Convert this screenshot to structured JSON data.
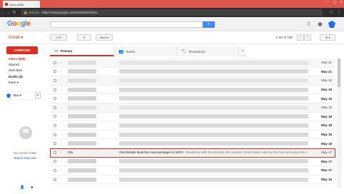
{
  "browser": {
    "tab_title": "Inbox (669)",
    "secure_label": "Secure",
    "url": "https://mail.google.com/mail/u/0/#inbox",
    "tab_close": "×",
    "back": "←",
    "forward": "→",
    "reload": "↻"
  },
  "header": {
    "logo_letters": [
      {
        "ch": "G",
        "color": "#4285f4"
      },
      {
        "ch": "o",
        "color": "#ea4335"
      },
      {
        "ch": "o",
        "color": "#fbbc05"
      },
      {
        "ch": "g",
        "color": "#4285f4"
      },
      {
        "ch": "l",
        "color": "#34a853"
      },
      {
        "ch": "e",
        "color": "#ea4335"
      }
    ],
    "search_icon": "⌕",
    "apps_icon": "⠿",
    "bell_icon": "◉"
  },
  "toolbar": {
    "gmail_label": "Gmail ▾",
    "refresh": "↻",
    "more_label": "More ▾",
    "pager": "1–50 of 739",
    "prev": "‹",
    "next": "›",
    "settings": "⚙ ▾"
  },
  "sidebar": {
    "compose": "COMPOSE",
    "items": [
      {
        "label": "Inbox (669)",
        "style": "active"
      },
      {
        "label": "Starred",
        "style": ""
      },
      {
        "label": "Sent Mail",
        "style": ""
      },
      {
        "label": "Drafts (4)",
        "style": "bold"
      },
      {
        "label": "More ▾",
        "style": ""
      }
    ],
    "hangouts_user": "Star ▾",
    "hangouts_plus": "+",
    "no_chats": "No recent chats",
    "start_new": "Start a new one"
  },
  "tabs": [
    {
      "label": "Primary",
      "icon": "▭",
      "active": true
    },
    {
      "label": "Social",
      "icon": "👥",
      "active": false
    },
    {
      "label": "Promotions",
      "icon": "🏷",
      "active": false
    }
  ],
  "tabs_plus": "+",
  "messages": [
    {
      "date": "May 21",
      "read": true
    },
    {
      "date": "May 21",
      "read": false
    },
    {
      "date": "May 19",
      "read": true
    },
    {
      "date": "May 19",
      "read": false
    },
    {
      "date": "May 19",
      "read": false
    },
    {
      "date": "May 18",
      "read": true
    },
    {
      "date": "May 18",
      "read": false
    },
    {
      "date": "May 18",
      "read": false
    },
    {
      "date": "May 18",
      "read": false
    },
    {
      "date": "May 18",
      "read": false
    },
    {
      "sender": "Ola",
      "subject": "Ola Rentals launches new packages in NCR!",
      "snippet": " - Breakfree with Ola Rentals this summer. Book these cabs by the hour and enjoy the c",
      "date": "May 17",
      "read": true,
      "highlight": true
    },
    {
      "date": "May 17",
      "read": false
    },
    {
      "date": "May 17",
      "read": false
    },
    {
      "date": "May 16",
      "read": false
    }
  ]
}
